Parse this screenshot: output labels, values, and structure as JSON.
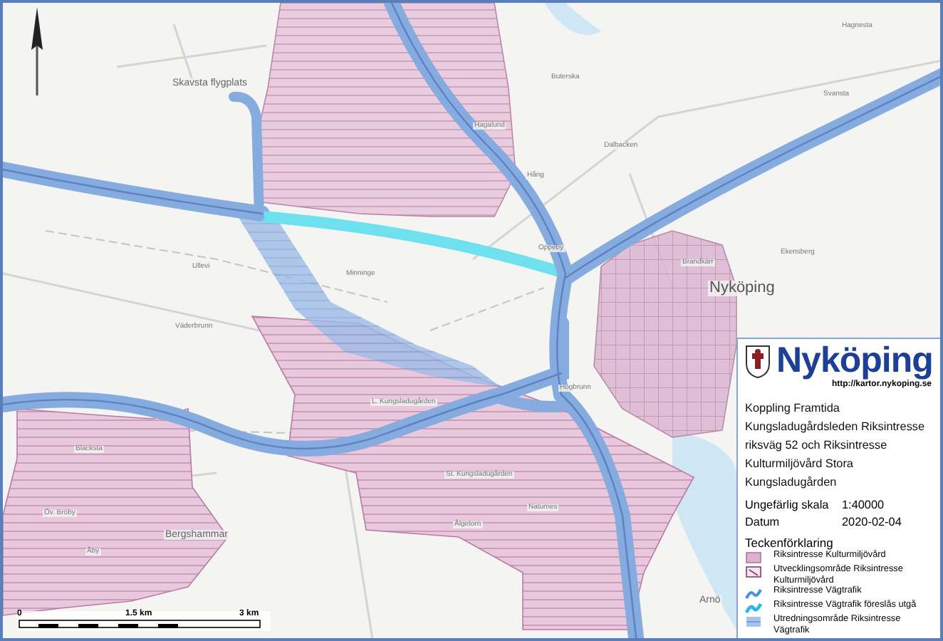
{
  "map": {
    "labels": [
      {
        "text": "Skavsta flygplats",
        "kind": "place"
      },
      {
        "text": "Nyköping",
        "kind": "town"
      },
      {
        "text": "Bergshammar",
        "kind": "place"
      },
      {
        "text": "Arnö",
        "kind": "place"
      },
      {
        "text": "Oppeby",
        "kind": "small"
      },
      {
        "text": "Hagalund",
        "kind": "small"
      },
      {
        "text": "Dalbacken",
        "kind": "small"
      },
      {
        "text": "Hång",
        "kind": "small"
      },
      {
        "text": "Brandkärr",
        "kind": "small"
      },
      {
        "text": "Ekensberg",
        "kind": "small"
      },
      {
        "text": "Svansta",
        "kind": "small"
      },
      {
        "text": "Hagnesta",
        "kind": "small"
      },
      {
        "text": "Buterska",
        "kind": "small"
      },
      {
        "text": "Minninge",
        "kind": "small"
      },
      {
        "text": "Ullevi",
        "kind": "small"
      },
      {
        "text": "Väderbrunn",
        "kind": "small"
      },
      {
        "text": "L. Kungsladugården",
        "kind": "small"
      },
      {
        "text": "St. Kungsladugården",
        "kind": "small"
      },
      {
        "text": "Blacksta",
        "kind": "small"
      },
      {
        "text": "Öv. Bröby",
        "kind": "small"
      },
      {
        "text": "Åby",
        "kind": "small"
      },
      {
        "text": "Högbrunn",
        "kind": "small"
      },
      {
        "text": "Naturnes",
        "kind": "small"
      },
      {
        "text": "Ålgetorn",
        "kind": "small"
      }
    ],
    "scale_bar": {
      "labels": [
        "0",
        "1.5 km",
        "3 km"
      ]
    }
  },
  "legend": {
    "title": "Nyköping",
    "url": "http://kartor.nykoping.se",
    "description": "Koppling Framtida Kungsladugårdsleden Riksintresse riksväg 52 och Riksintresse Kulturmiljövård Stora Kungsladugården",
    "details": [
      {
        "label": "Ungefärlig skala",
        "value": "1:40000"
      },
      {
        "label": "Datum",
        "value": "2020-02-04"
      }
    ],
    "key_title": "Teckenförklaring",
    "items": [
      {
        "kind": "area",
        "text": "Riksintresse Kulturmiljövård"
      },
      {
        "kind": "hatched",
        "text": "Utvecklingsområde Riksintresse Kulturmiljövård"
      },
      {
        "kind": "road",
        "text": "Riksintresse Vägtrafik"
      },
      {
        "kind": "proposed",
        "text": "Riksintresse Vägtrafik föreslås utgå"
      },
      {
        "kind": "study",
        "text": "Utredningsområde Riksintresse Vägtrafik"
      }
    ]
  }
}
